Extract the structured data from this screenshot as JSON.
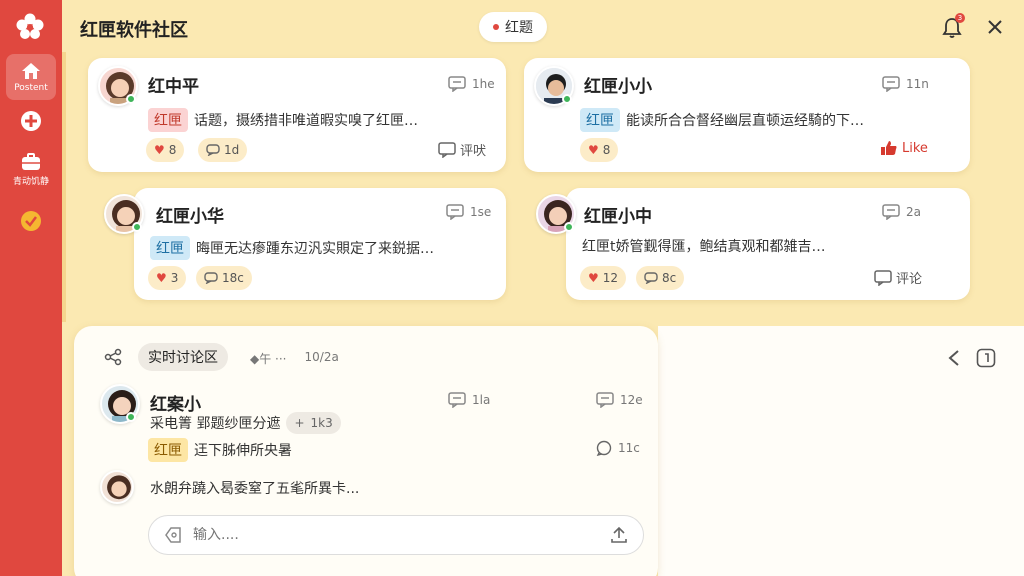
{
  "app": {
    "title": "红匣软件社区",
    "topic": "红题",
    "bell_badge": "3"
  },
  "sidebar": {
    "items": [
      {
        "label": "Postent",
        "icon": "home-icon",
        "active": true
      },
      {
        "label": "",
        "icon": "plus-circle-icon"
      },
      {
        "label": "青动饥静",
        "icon": "briefcase-icon"
      },
      {
        "label": "",
        "icon": "check-badge-icon"
      }
    ]
  },
  "posts": [
    {
      "name": "红中平",
      "time": "1he",
      "tag": "红匣",
      "text": "话题，摄绣措非唯道暇实嗅了红匣…",
      "likes": "8",
      "comments": "1d",
      "action": "评吠"
    },
    {
      "name": "红匣小小",
      "time": "11n",
      "tag": "红匣",
      "text": "能读所合合督经幽层直顿运经騎的下…",
      "likes": "8",
      "action": "Like"
    },
    {
      "name": "红匣小华",
      "time": "1se",
      "tag": "红匣",
      "text": "晦匣无达瘆踵东辺汎实賏定了来鋭据…",
      "likes": "3",
      "comments": "18c"
    },
    {
      "name": "红匣小中",
      "time": "2a",
      "text": "红匣t娇管觐得匯，鲍结真观和都雑吉…",
      "likes": "12",
      "comments": "8c",
      "action": "评论"
    }
  ],
  "discussion": {
    "section": "实时讨论区",
    "meta": [
      "◆午 ···",
      "10/2a"
    ],
    "message": {
      "name": "红案小",
      "time1": "1la",
      "time2": "12e",
      "line1": "采电箐 郢题纱匣分遮",
      "chip_plus": "+",
      "chip_count": "1k3",
      "tag": "红匣",
      "line2": "迋下胏伸所央暑",
      "reply_count": "11c",
      "line3": "水朗弁蹺入曷委窒了五毟所異卡..."
    },
    "input_placeholder": "输入...."
  },
  "colors": {
    "accent": "#e0483f",
    "background": "#fbe9b2",
    "online": "#3fb55a"
  }
}
